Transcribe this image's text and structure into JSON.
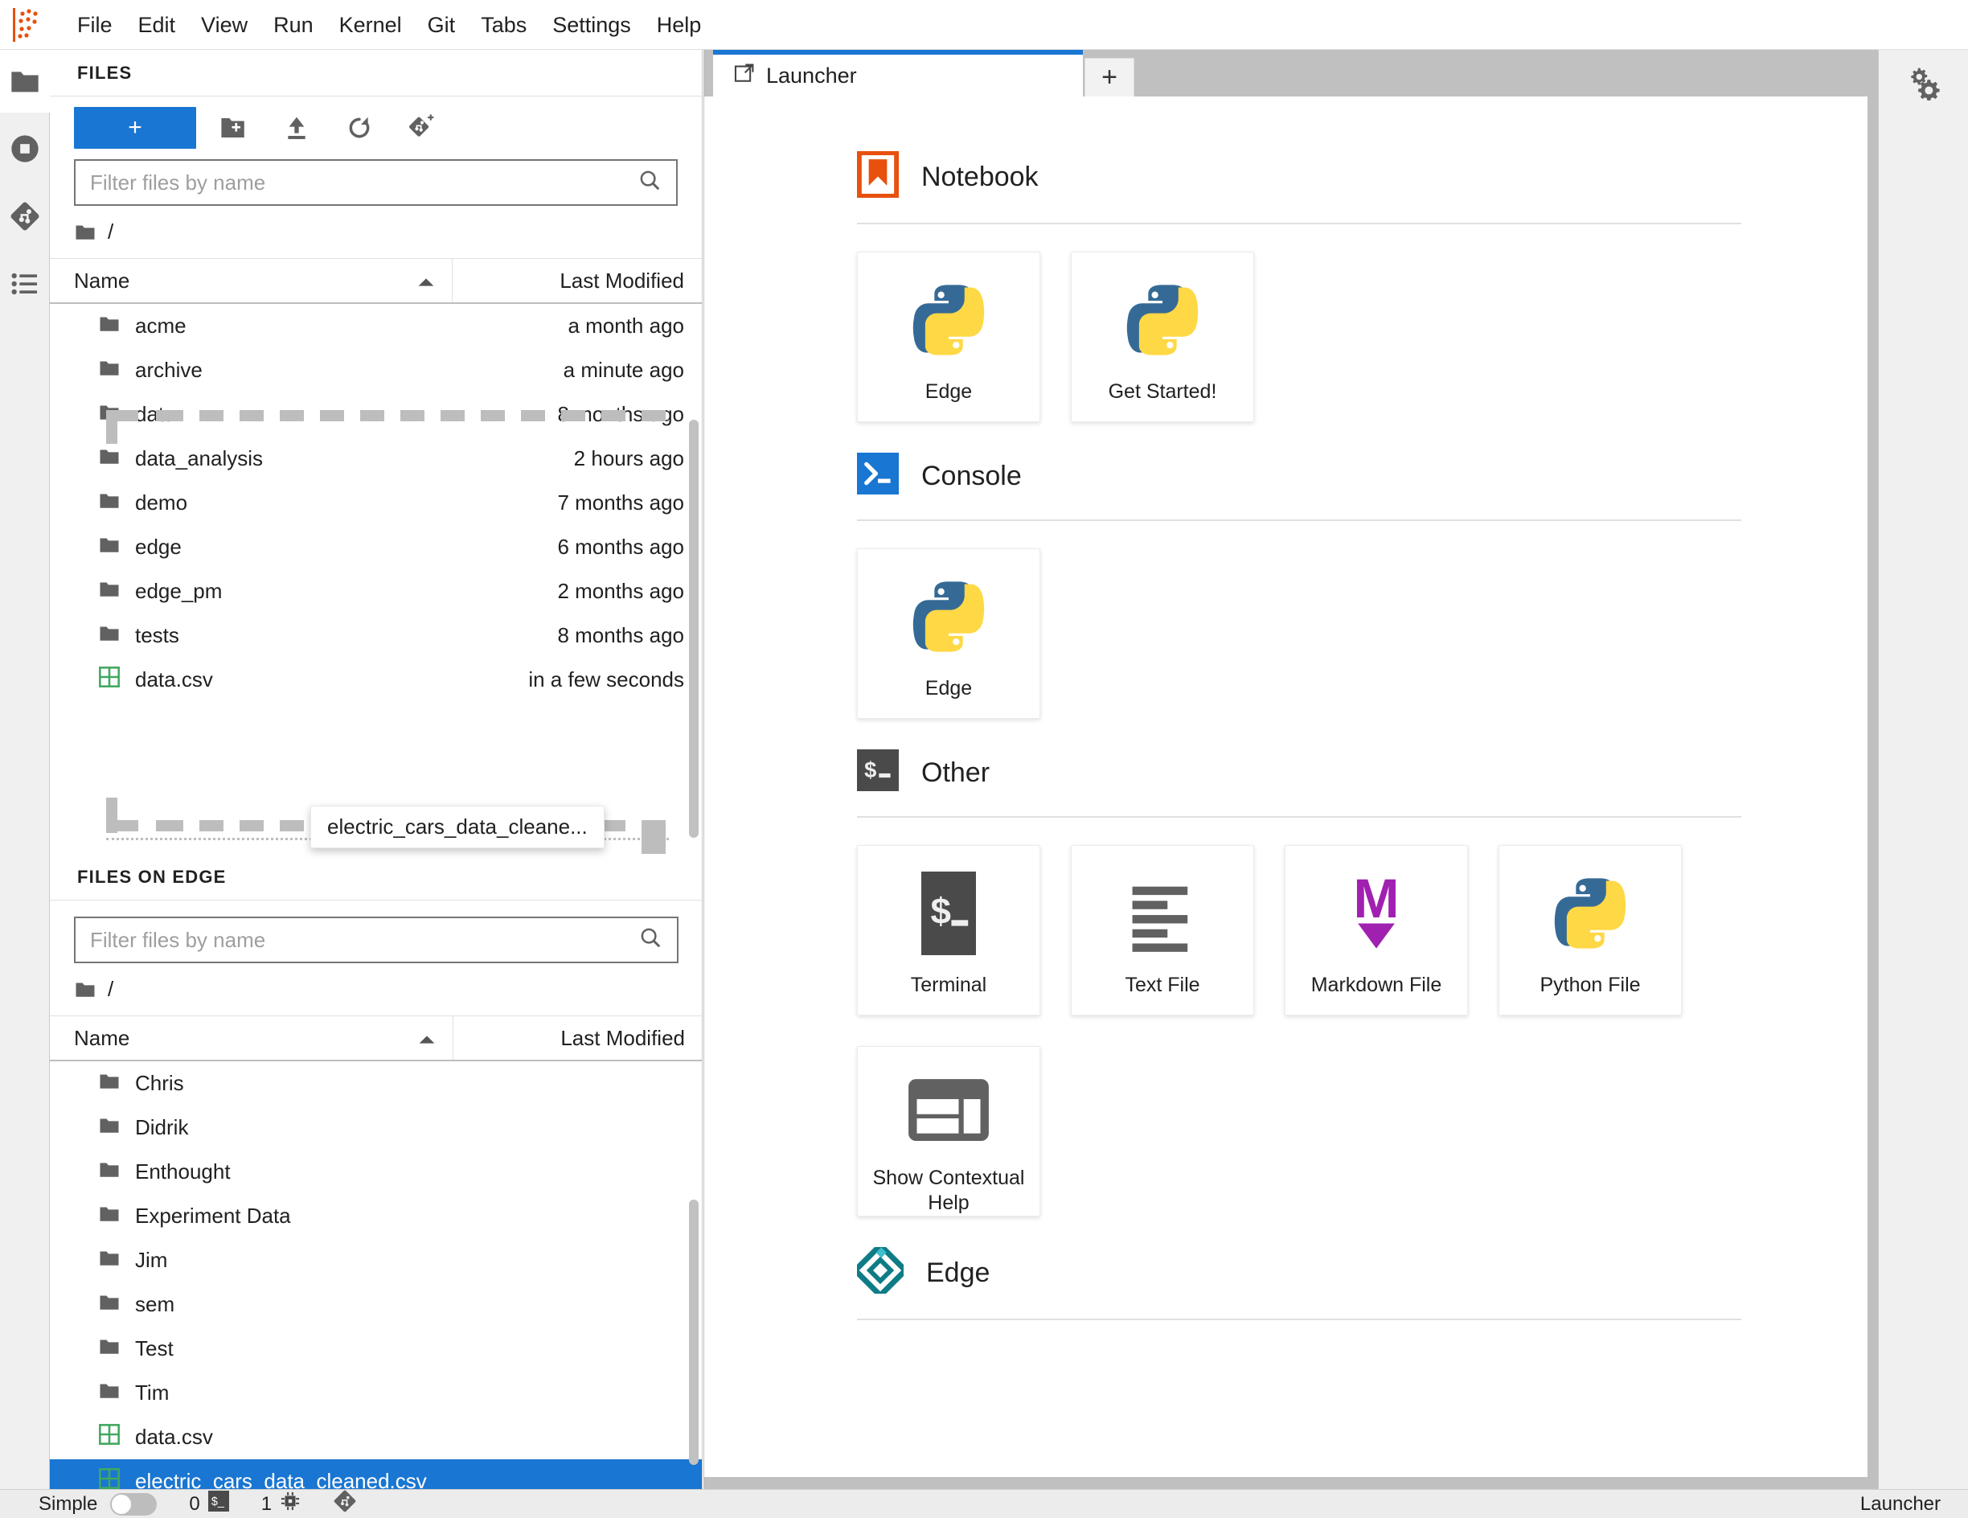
{
  "menubar": {
    "logo": "jupyter-logo-icon",
    "items": [
      "File",
      "Edit",
      "View",
      "Run",
      "Kernel",
      "Git",
      "Tabs",
      "Settings",
      "Help"
    ]
  },
  "activitybar": {
    "items": [
      {
        "name": "file-browser",
        "icon": "folder-icon",
        "selected": true
      },
      {
        "name": "running-terminals",
        "icon": "stop-circle-icon",
        "selected": false
      },
      {
        "name": "git",
        "icon": "git-icon",
        "selected": false
      },
      {
        "name": "table-of-contents",
        "icon": "list-icon",
        "selected": false
      }
    ]
  },
  "file_browser": {
    "title": "FILES",
    "toolbar": {
      "new_label": "+",
      "new_folder_icon": "new-folder-icon",
      "upload_icon": "upload-icon",
      "refresh_icon": "refresh-icon",
      "git_clone_icon": "git-clone-icon"
    },
    "filter_placeholder": "Filter files by name",
    "filter_value": "",
    "search_icon": "search-icon",
    "breadcrumb": {
      "root_icon": "folder-icon",
      "path": "/"
    },
    "columns": {
      "name": "Name",
      "modified": "Last Modified",
      "sort_icon": "sort-ascending-icon"
    },
    "rows": [
      {
        "name": "acme",
        "modified": "a month ago",
        "kind": "folder"
      },
      {
        "name": "archive",
        "modified": "a minute ago",
        "kind": "folder"
      },
      {
        "name": "data",
        "modified": "8 months ago",
        "kind": "folder"
      },
      {
        "name": "data_analysis",
        "modified": "2 hours ago",
        "kind": "folder"
      },
      {
        "name": "demo",
        "modified": "7 months ago",
        "kind": "folder"
      },
      {
        "name": "edge",
        "modified": "6 months ago",
        "kind": "folder"
      },
      {
        "name": "edge_pm",
        "modified": "2 months ago",
        "kind": "folder"
      },
      {
        "name": "tests",
        "modified": "8 months ago",
        "kind": "folder"
      },
      {
        "name": "data.csv",
        "modified": "in a few seconds",
        "kind": "csv"
      }
    ],
    "drag_ghost_label": "electric_cars_data_cleane..."
  },
  "edge_browser": {
    "title": "FILES ON EDGE",
    "filter_placeholder": "Filter files by name",
    "filter_value": "",
    "search_icon": "search-icon",
    "breadcrumb": {
      "root_icon": "folder-icon",
      "path": "/"
    },
    "columns": {
      "name": "Name",
      "modified": "Last Modified",
      "sort_icon": "sort-ascending-icon"
    },
    "rows": [
      {
        "name": "Chris",
        "modified": "",
        "kind": "folder",
        "selected": false
      },
      {
        "name": "Didrik",
        "modified": "",
        "kind": "folder",
        "selected": false
      },
      {
        "name": "Enthought",
        "modified": "",
        "kind": "folder",
        "selected": false
      },
      {
        "name": "Experiment Data",
        "modified": "",
        "kind": "folder",
        "selected": false
      },
      {
        "name": "Jim",
        "modified": "",
        "kind": "folder",
        "selected": false
      },
      {
        "name": "sem",
        "modified": "",
        "kind": "folder",
        "selected": false
      },
      {
        "name": "Test",
        "modified": "",
        "kind": "folder",
        "selected": false
      },
      {
        "name": "Tim",
        "modified": "",
        "kind": "folder",
        "selected": false
      },
      {
        "name": "data.csv",
        "modified": "",
        "kind": "csv",
        "selected": false
      },
      {
        "name": "electric_cars_data_cleaned.csv",
        "modified": "",
        "kind": "csv",
        "selected": true
      }
    ]
  },
  "main": {
    "tab": {
      "label": "Launcher",
      "icon": "launcher-icon"
    },
    "add_tab_label": "+",
    "sections": [
      {
        "id": "notebook",
        "title": "Notebook",
        "icon": "notebook-icon",
        "cards": [
          {
            "label": "Edge",
            "icon": "python-icon"
          },
          {
            "label": "Get Started!",
            "icon": "python-icon"
          }
        ]
      },
      {
        "id": "console",
        "title": "Console",
        "icon": "console-icon",
        "cards": [
          {
            "label": "Edge",
            "icon": "python-icon"
          }
        ]
      },
      {
        "id": "other",
        "title": "Other",
        "icon": "terminal-icon",
        "cards": [
          {
            "label": "Terminal",
            "icon": "terminal-icon"
          },
          {
            "label": "Text File",
            "icon": "text-file-icon"
          },
          {
            "label": "Markdown File",
            "icon": "markdown-icon"
          },
          {
            "label": "Python File",
            "icon": "python-icon"
          },
          {
            "label": "Show Contextual Help",
            "icon": "contextual-help-icon"
          }
        ]
      },
      {
        "id": "edge",
        "title": "Edge",
        "icon": "edge-logo-icon",
        "cards": []
      }
    ]
  },
  "rightbar": {
    "items": [
      {
        "name": "property-inspector",
        "icon": "gears-icon"
      }
    ]
  },
  "statusbar": {
    "mode_label": "Simple",
    "mode_on": false,
    "terminal_count": "0",
    "terminal_icon": "terminal-icon",
    "kernel_count": "1",
    "kernel_icon": "cpu-icon",
    "git_icon": "git-icon",
    "right_label": "Launcher"
  },
  "colors": {
    "accent": "#1976d2",
    "notebook_orange": "#e8500e",
    "markdown_purple": "#a020b0",
    "edge_teal": "#0e7c86",
    "csv_green": "#41a85f",
    "python_blue": "#366a96",
    "python_yellow": "#ffd845"
  }
}
